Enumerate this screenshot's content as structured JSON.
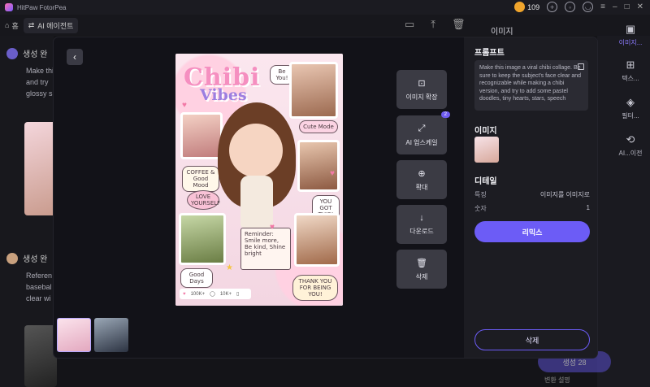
{
  "app": {
    "name": "HitPaw FotorPea",
    "coins": "109"
  },
  "toolbar": {
    "home_label": "홈",
    "crumb_label": "AI 에이전트"
  },
  "background": {
    "items": [
      {
        "title": "생성 완",
        "text": [
          "Make thi",
          "and try",
          "glossy s"
        ]
      },
      {
        "title": "생성 완",
        "text": [
          "Referen",
          "basebal",
          "clear wi"
        ]
      }
    ],
    "right_nav": [
      {
        "icon": "image-icon",
        "label": "이미지..."
      },
      {
        "icon": "text-icon",
        "label": "텍스..."
      },
      {
        "icon": "filter-icon",
        "label": "필터..."
      },
      {
        "icon": "ai-icon",
        "label": "AI...이전"
      }
    ],
    "right_label": "이미지",
    "generate_label": "생성 28",
    "generate_note": "변환 설명"
  },
  "modal": {
    "image": {
      "title": "Chibi",
      "subtitle": "Vibes",
      "bubble_be_you": "Be You!",
      "bubble_cute": "Cute Mode",
      "bubble_coffee": "COFFEE & Good Mood",
      "bubble_love": "LOVE YOURSELF",
      "bubble_got": "YOU GOT THIS!",
      "bubble_reminder": "Reminder: Smile more, Be kind, Shine bright",
      "bubble_thanks": "THANK YOU FOR BEING YOU!",
      "bubble_good_days": "Good Days",
      "likes": "100K+",
      "comments": "10K+"
    },
    "tools": [
      {
        "icon": "expand-image-icon",
        "label": "이미지 확장",
        "badge": ""
      },
      {
        "icon": "upscale-icon",
        "label": "AI 업스케일",
        "badge": "2"
      },
      {
        "icon": "zoom-icon",
        "label": "확대",
        "badge": ""
      },
      {
        "icon": "download-icon",
        "label": "다운로드",
        "badge": ""
      },
      {
        "icon": "trash-icon",
        "label": "삭제",
        "badge": ""
      }
    ],
    "panel": {
      "prompt_title": "프롬프트",
      "prompt_text": "Make this image a viral chibi collage. Be sure to keep the subject's face clear and recognizable while making a chibi version, and try to add some pastel doodles, tiny hearts, stars, speech",
      "image_title": "이미지",
      "details_title": "디테일",
      "details": [
        {
          "key": "특징",
          "value": "이미지를 이미지로"
        },
        {
          "key": "숫자",
          "value": "1"
        }
      ],
      "remix_label": "리믹스",
      "delete_label": "삭제"
    }
  }
}
